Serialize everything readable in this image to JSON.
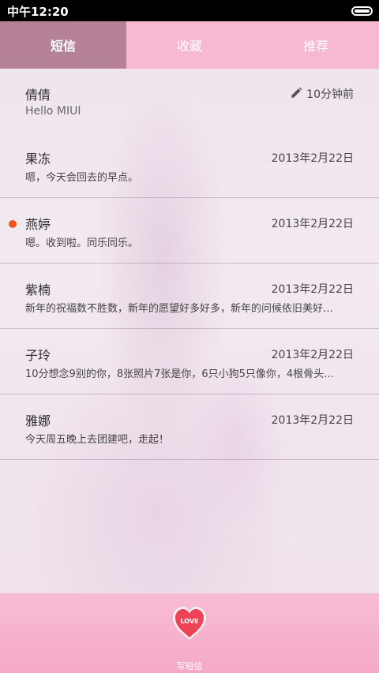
{
  "status_bar": {
    "time": "中午12:20",
    "icons": [
      "battery-icon"
    ]
  },
  "tabs": [
    {
      "label": "短信",
      "active": true
    },
    {
      "label": "收藏",
      "active": false
    },
    {
      "label": "推荐",
      "active": false
    }
  ],
  "messages": [
    {
      "name": "倩倩",
      "preview": "Hello MIUI",
      "time": "10分钟前",
      "draft": true,
      "unread": false
    },
    {
      "name": "果冻",
      "preview": "嗯，今天会回去的早点。",
      "time": "2013年2月22日",
      "unread": false
    },
    {
      "name": "燕婷",
      "preview": "嗯。收到啦。同乐同乐。",
      "time": "2013年2月22日",
      "unread": true
    },
    {
      "name": "紫楠",
      "preview": "新年的祝福数不胜数，新年的愿望好多好多，新年的问候依旧美好…",
      "time": "2013年2月22日",
      "unread": false
    },
    {
      "name": "子玲",
      "preview": "10分想念9别的你，8张照片7张是你，6只小狗5只像你，4根骨头…",
      "time": "2013年2月22日",
      "unread": false
    },
    {
      "name": "雅娜",
      "preview": "今天周五晚上去团建吧，走起！",
      "time": "2013年2月22日",
      "unread": false
    }
  ],
  "compose": {
    "icon_text": "LOVE",
    "label": "写短信",
    "icon": "heart-icon"
  },
  "colors": {
    "status_bar": "#000000",
    "tab_bar": "#f6b9d1",
    "tab_active": "#b48196",
    "bottom_bar": "#f6b3ce",
    "unread_dot": "#f0541b",
    "heart": "#ee4356"
  }
}
